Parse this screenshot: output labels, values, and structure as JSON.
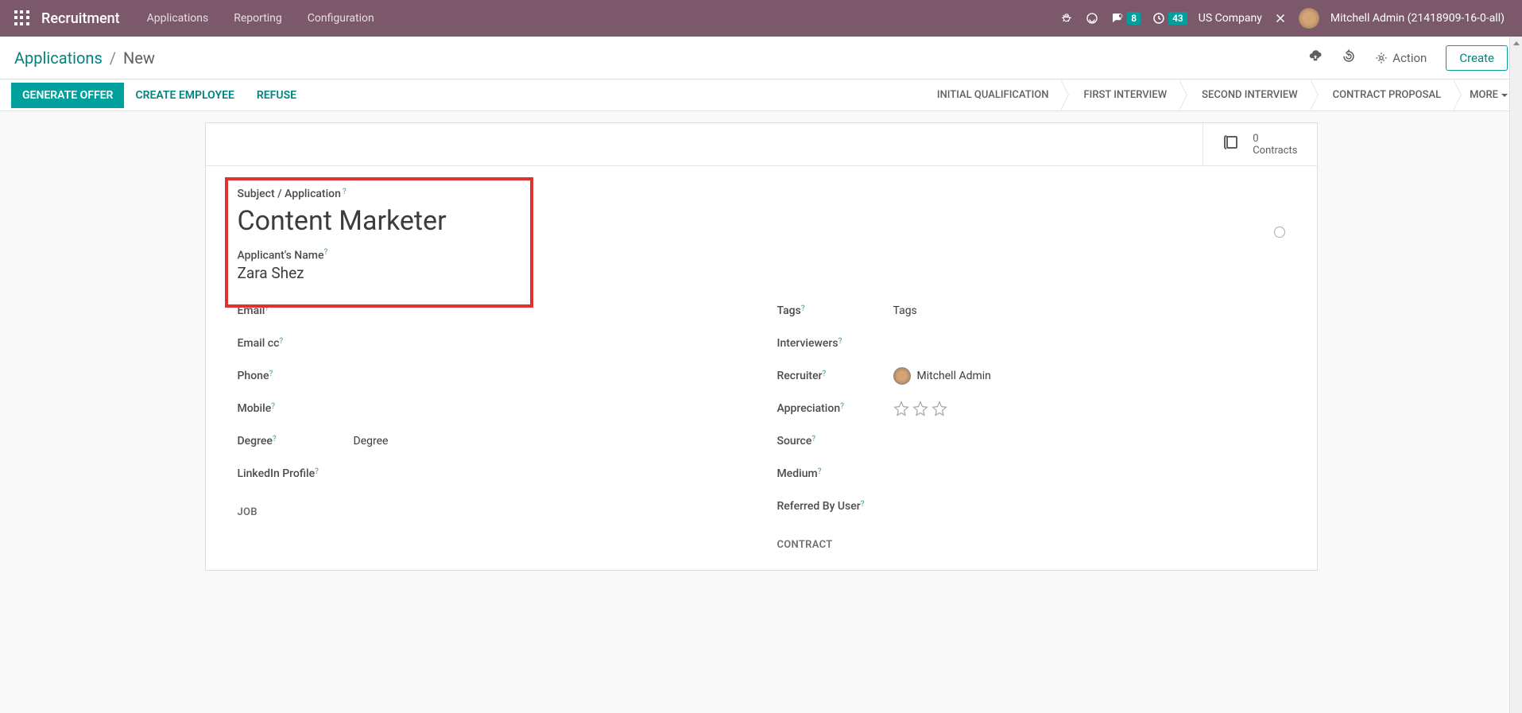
{
  "nav": {
    "app_title": "Recruitment",
    "links": [
      "Applications",
      "Reporting",
      "Configuration"
    ],
    "messages_badge": "8",
    "activities_badge": "43",
    "company": "US Company",
    "user": "Mitchell Admin (21418909-16-0-all)"
  },
  "breadcrumb": {
    "parent": "Applications",
    "current": "New"
  },
  "actions": {
    "action_label": "Action",
    "create_label": "Create"
  },
  "status": {
    "generate_offer": "GENERATE OFFER",
    "create_employee": "CREATE EMPLOYEE",
    "refuse": "REFUSE",
    "stages": [
      "INITIAL QUALIFICATION",
      "FIRST INTERVIEW",
      "SECOND INTERVIEW",
      "CONTRACT PROPOSAL"
    ],
    "more": "MORE"
  },
  "smart": {
    "contracts_count": "0",
    "contracts_label": "Contracts"
  },
  "form": {
    "subject_label": "Subject / Application",
    "subject_value": "Content Marketer",
    "name_label": "Applicant's Name",
    "name_value": "Zara Shez",
    "left": {
      "email": "Email",
      "email_cc": "Email cc",
      "phone": "Phone",
      "mobile": "Mobile",
      "degree": "Degree",
      "degree_placeholder": "Degree",
      "linkedin": "LinkedIn Profile"
    },
    "right": {
      "tags": "Tags",
      "tags_placeholder": "Tags",
      "interviewers": "Interviewers",
      "recruiter": "Recruiter",
      "recruiter_value": "Mitchell Admin",
      "appreciation": "Appreciation",
      "source": "Source",
      "medium": "Medium",
      "referred": "Referred By User"
    },
    "sections": {
      "job": "JOB",
      "contract": "CONTRACT"
    }
  }
}
